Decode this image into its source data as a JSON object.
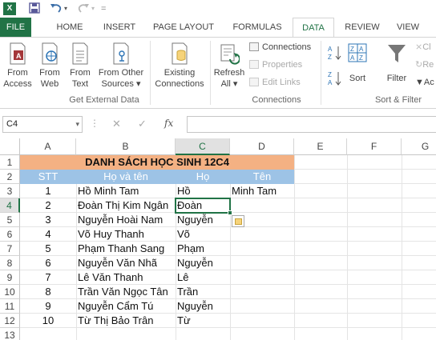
{
  "app_icon": "X",
  "tabs": [
    "FILE",
    "HOME",
    "INSERT",
    "PAGE LAYOUT",
    "FORMULAS",
    "DATA",
    "REVIEW",
    "VIEW"
  ],
  "active_tab": "DATA",
  "ribbon": {
    "get_external": {
      "from_access": [
        "From",
        "Access"
      ],
      "from_web": [
        "From",
        "Web"
      ],
      "from_text": [
        "From",
        "Text"
      ],
      "from_other": [
        "From Other",
        "Sources ▾"
      ],
      "existing": [
        "Existing",
        "Connections"
      ],
      "label": "Get External Data"
    },
    "connections": {
      "refresh": [
        "Refresh",
        "All ▾"
      ],
      "connections": "Connections",
      "properties": "Properties",
      "edit_links": "Edit Links",
      "label": "Connections"
    },
    "sort_filter": {
      "sort": "Sort",
      "filter": "Filter",
      "label": "Sort & Filter",
      "clear": "Cl",
      "reapply": "Re",
      "advanced": "Ac"
    }
  },
  "formula_bar": {
    "name_box": "C4",
    "fx": "fx",
    "value": ""
  },
  "columns": [
    "A",
    "B",
    "C",
    "D",
    "E",
    "F",
    "G"
  ],
  "rows": [
    "1",
    "2",
    "3",
    "4",
    "5",
    "6",
    "7",
    "8",
    "9",
    "10",
    "11",
    "12",
    "13"
  ],
  "sheet": {
    "title": "DANH SÁCH HỌC SINH 12C4",
    "headers": [
      "STT",
      "Họ và tên",
      "Họ",
      "Tên"
    ],
    "records": [
      {
        "stt": "1",
        "full": "Hồ Minh Tam",
        "ho": "Hồ",
        "ten": "Minh Tam"
      },
      {
        "stt": "2",
        "full": "Đoàn Thị Kim Ngân",
        "ho": "Đoàn",
        "ten": ""
      },
      {
        "stt": "3",
        "full": "Nguyễn Hoài Nam",
        "ho": "Nguyễn",
        "ten": ""
      },
      {
        "stt": "4",
        "full": "Võ Huy Thanh",
        "ho": "Võ",
        "ten": ""
      },
      {
        "stt": "5",
        "full": "Phạm Thanh Sang",
        "ho": "Phạm",
        "ten": ""
      },
      {
        "stt": "6",
        "full": "Nguyễn Văn Nhã",
        "ho": "Nguyễn",
        "ten": ""
      },
      {
        "stt": "7",
        "full": "Lê Văn Thanh",
        "ho": "Lê",
        "ten": ""
      },
      {
        "stt": "8",
        "full": "Trần Văn Ngọc Tân",
        "ho": "Trần",
        "ten": ""
      },
      {
        "stt": "9",
        "full": "Nguyễn Cẩm Tú",
        "ho": "Nguyễn",
        "ten": ""
      },
      {
        "stt": "10",
        "full": "Từ Thị Bảo Trân",
        "ho": "Từ",
        "ten": ""
      }
    ]
  },
  "colors": {
    "accent": "#217346",
    "title_fill": "#f4b183",
    "header_fill": "#9dc3e6"
  }
}
